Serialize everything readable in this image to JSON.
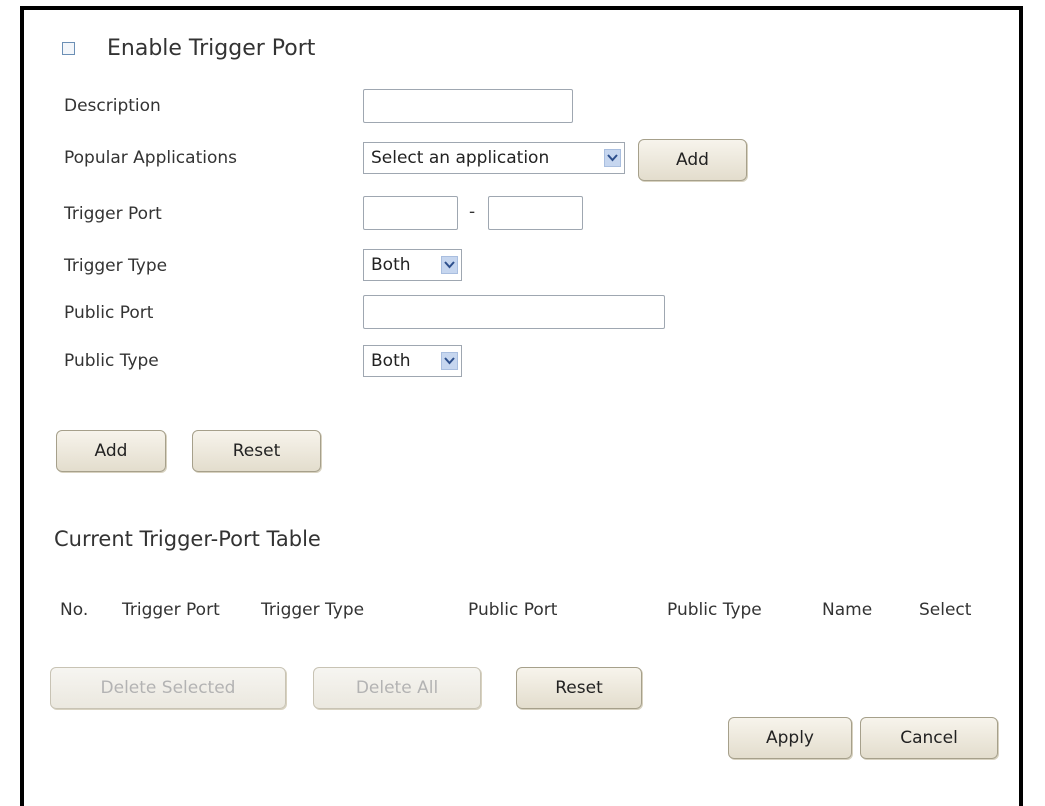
{
  "form": {
    "enable_label": "Enable Trigger Port",
    "enable_checked": false,
    "description_label": "Description",
    "description_value": "",
    "popular_apps_label": "Popular Applications",
    "popular_apps_selected": "Select an application",
    "popular_add_button": "Add",
    "trigger_port_label": "Trigger Port",
    "trigger_port_separator": "-",
    "trigger_port_from": "",
    "trigger_port_to": "",
    "trigger_type_label": "Trigger Type",
    "trigger_type_selected": "Both",
    "public_port_label": "Public Port",
    "public_port_value": "",
    "public_type_label": "Public Type",
    "public_type_selected": "Both",
    "add_button": "Add",
    "reset_button": "Reset"
  },
  "table": {
    "title": "Current Trigger-Port Table",
    "columns": [
      "No.",
      "Trigger Port",
      "Trigger Type",
      "Public Port",
      "Public Type",
      "Name",
      "Select"
    ],
    "rows": [],
    "delete_selected_button": "Delete Selected",
    "delete_all_button": "Delete All",
    "reset_button": "Reset"
  },
  "footer": {
    "apply_button": "Apply",
    "cancel_button": "Cancel"
  },
  "icons": {
    "dropdown": "chevron-down-icon"
  },
  "colors": {
    "button_bg": "#e9e4d6",
    "dropdown_arrow_bg": "#c6d6ef",
    "disabled_text": "#b3b3b3"
  }
}
